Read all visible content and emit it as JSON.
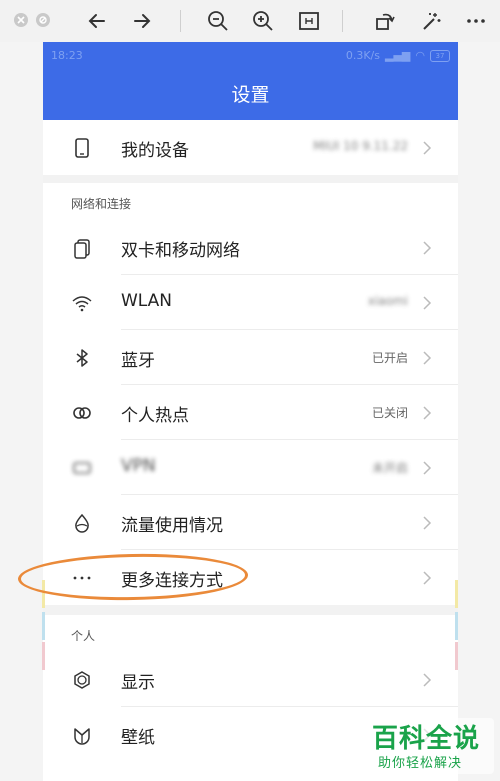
{
  "viewer": {
    "icons": [
      "close-icon",
      "minimize-icon",
      "back-arrow-icon",
      "forward-arrow-icon",
      "zoom-out-icon",
      "zoom-in-icon",
      "fit-window-icon",
      "rotate-icon",
      "magic-wand-icon",
      "more-icon"
    ]
  },
  "status_bar": {
    "time": "18:23",
    "network_speed": "0.3K/s",
    "battery": "37"
  },
  "header": {
    "title": "设置"
  },
  "rows": [
    {
      "label": "我的设备",
      "value": "MIUI 10 9.11.22",
      "icon": "phone-icon"
    },
    {
      "label": "双卡和移动网络",
      "value": "",
      "icon": "sim-card-icon"
    },
    {
      "label": "WLAN",
      "value": "xiaomi",
      "icon": "wifi-icon"
    },
    {
      "label": "蓝牙",
      "value": "已开启",
      "icon": "bluetooth-icon"
    },
    {
      "label": "个人热点",
      "value": "已关闭",
      "icon": "hotspot-icon"
    },
    {
      "label": "VPN",
      "value": "未开启",
      "icon": "vpn-icon"
    },
    {
      "label": "流量使用情况",
      "value": "",
      "icon": "data-usage-icon"
    },
    {
      "label": "更多连接方式",
      "value": "",
      "icon": "more-dots-icon"
    },
    {
      "label": "显示",
      "value": "",
      "icon": "display-icon"
    },
    {
      "label": "壁纸",
      "value": "",
      "icon": "wallpaper-icon"
    }
  ],
  "sections": {
    "network": "网络和连接",
    "personal": "个人"
  },
  "watermark": {
    "line1": "百科全说",
    "line2": "助你轻松解决"
  },
  "colors": {
    "header_blue": "#3d6be7",
    "highlight_orange": "#ea8a3a",
    "watermark_green": "#1aa34a"
  }
}
